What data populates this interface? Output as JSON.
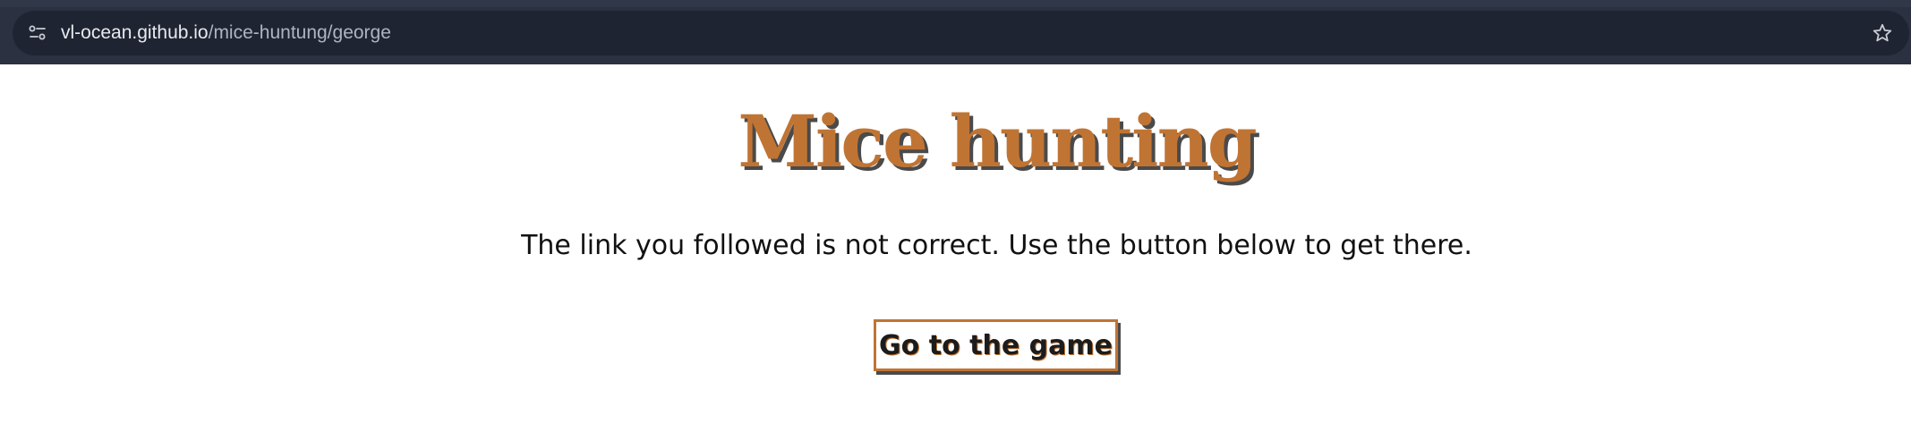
{
  "browser": {
    "url_host": "vl-ocean.github.io",
    "url_path": "/mice-huntung/george",
    "site_info_icon": "tune-icon",
    "bookmark_icon": "star-outline-icon"
  },
  "page": {
    "title": "Mice hunting",
    "message": "The link you followed is not correct. Use the button below to get there.",
    "button_label": "Go to the game"
  },
  "colors": {
    "accent": "#c07433",
    "shadow": "#4a4a4a",
    "browser_bar": "#2b3140",
    "omnibox": "#1f2433"
  }
}
